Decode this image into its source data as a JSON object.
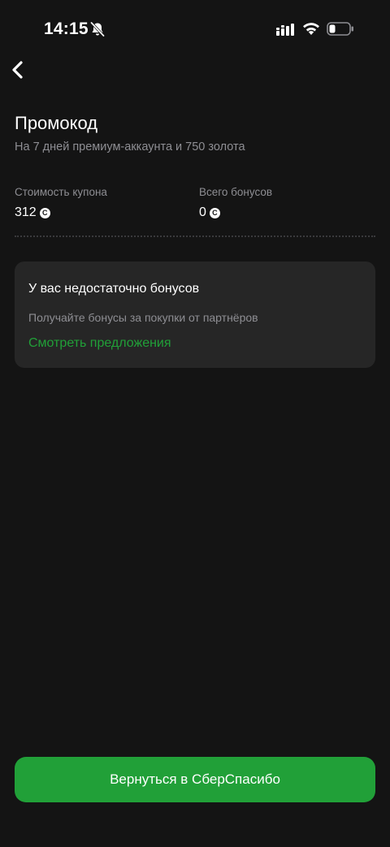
{
  "status_bar": {
    "time": "14:15",
    "icons": [
      "bell-muted-icon",
      "signal-icon",
      "wifi-icon",
      "battery-icon"
    ]
  },
  "header": {
    "back_icon": "chevron-left-icon",
    "title": "Промокод",
    "subtitle": "На 7 дней премиум-аккаунта и 750 золота"
  },
  "stats": {
    "coupon_cost_label": "Стоимость купона",
    "coupon_cost_value": "312",
    "total_bonuses_label": "Всего бонусов",
    "total_bonuses_value": "0",
    "coin_glyph": "С"
  },
  "notice": {
    "title": "У вас недостаточно бонусов",
    "text": "Получайте бонусы за покупки от партнёров",
    "link": "Смотреть предложения"
  },
  "footer": {
    "button_label": "Вернуться в СберСпасибо"
  },
  "colors": {
    "background": "#141414",
    "card": "#262626",
    "accent": "#21a038",
    "muted_text": "#8e8e93"
  }
}
